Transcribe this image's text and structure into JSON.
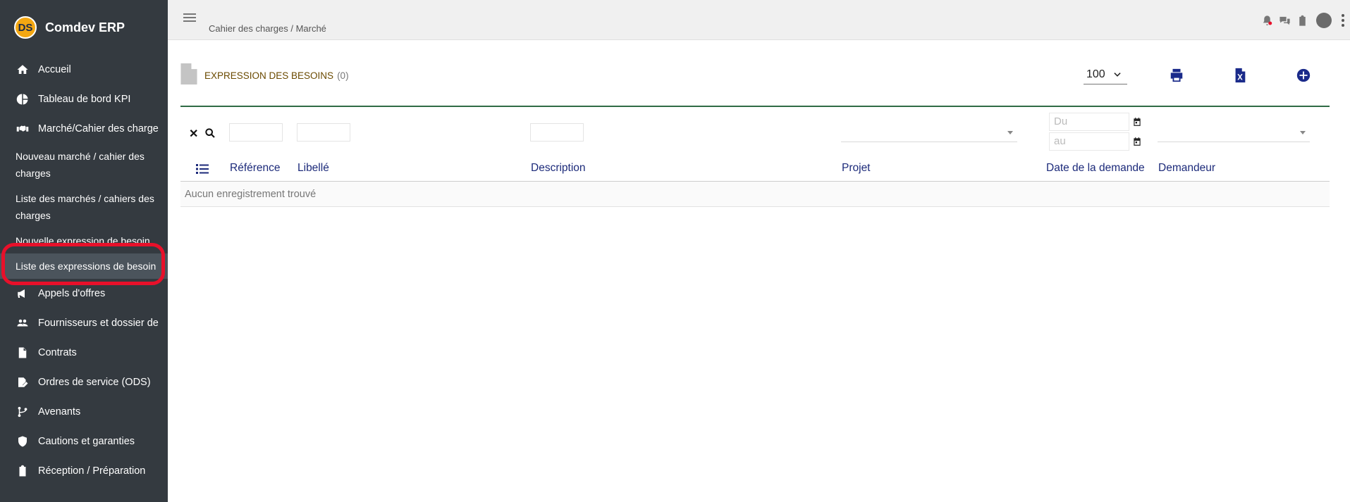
{
  "app": {
    "brand_initials": "DS",
    "brand_name": "Comdev ERP"
  },
  "sidebar": {
    "items": [
      {
        "label": "Accueil",
        "icon": "home-icon"
      },
      {
        "label": "Tableau de bord KPI",
        "icon": "pie-chart-icon"
      },
      {
        "label": "Marché/Cahier des charge",
        "icon": "handshake-icon"
      }
    ],
    "sub_items": [
      {
        "label": "Nouveau marché / cahier des charges"
      },
      {
        "label": "Liste des marchés / cahiers des charges"
      },
      {
        "label": "Nouvelle expression de besoin"
      },
      {
        "label": "Liste des expressions de besoin",
        "active": true
      }
    ],
    "items_after": [
      {
        "label": "Appels d'offres",
        "icon": "megaphone-icon"
      },
      {
        "label": "Fournisseurs et dossier de",
        "icon": "users-icon"
      },
      {
        "label": "Contrats",
        "icon": "contract-icon"
      },
      {
        "label": "Ordres de service (ODS)",
        "icon": "edit-document-icon"
      },
      {
        "label": "Avenants",
        "icon": "branch-icon"
      },
      {
        "label": "Cautions et garanties",
        "icon": "shield-icon"
      },
      {
        "label": "Réception / Préparation",
        "icon": "clipboard-check-icon"
      }
    ]
  },
  "topbar": {
    "breadcrumb": "Cahier des charges / Marché"
  },
  "page": {
    "title": "EXPRESSION DES BESOINS",
    "count": "(0)",
    "rows_per_page": "100"
  },
  "filters": {
    "date_from_placeholder": "Du",
    "date_to_placeholder": "au"
  },
  "table": {
    "columns": [
      "Référence",
      "Libellé",
      "Description",
      "Projet",
      "Date de la demande",
      "Demandeur"
    ],
    "empty_message": "Aucun enregistrement trouvé"
  },
  "colors": {
    "sidebar_bg": "#343a40",
    "accent_blue": "#1a2a8a",
    "highlight_red": "#e8102a",
    "table_top_border": "#2f6b45"
  }
}
